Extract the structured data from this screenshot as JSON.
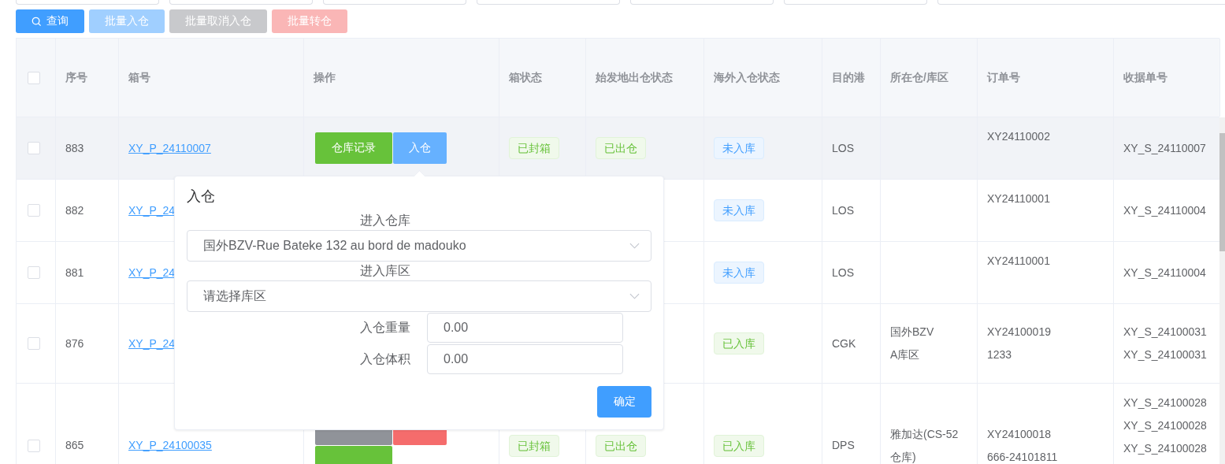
{
  "filter_fields": [
    {
      "kind": "field"
    },
    {
      "kind": "field"
    },
    {
      "kind": "field"
    },
    {
      "kind": "field"
    },
    {
      "kind": "field"
    },
    {
      "kind": "field"
    },
    {
      "kind": "field"
    }
  ],
  "toolbar": [
    {
      "label": "查询",
      "kind": "primary",
      "disabled": false
    },
    {
      "label": "批量入仓",
      "kind": "primary",
      "disabled": true
    },
    {
      "label": "批量取消入仓",
      "kind": "info",
      "disabled": true
    },
    {
      "label": "批量转仓",
      "kind": "danger",
      "disabled": true
    }
  ],
  "table": {
    "header_checkbox": {
      "checked": false
    },
    "columns": [
      "序号",
      "箱号",
      "操作",
      "箱状态",
      "始发地出仓状态",
      "海外入仓状态",
      "目的港",
      "所在仓/库区",
      "订单号",
      "收据单号"
    ],
    "rows": [
      {
        "highlighted": true,
        "checked": false,
        "index": "883",
        "box_no": "XY_P_24110007",
        "actions": [
          {
            "label": "仓库记录",
            "kind": "success"
          },
          {
            "label": "入仓",
            "kind": "primary-light"
          }
        ],
        "box_status": {
          "label": "已封箱",
          "kind": "success"
        },
        "origin_status": {
          "label": "已出仓",
          "kind": "success"
        },
        "overseas_status": {
          "label": "未入库",
          "kind": "primary"
        },
        "port": "LOS",
        "location": [],
        "orders": [
          "XY24110002"
        ],
        "receipts": [
          "XY_S_24110007"
        ]
      },
      {
        "highlighted": false,
        "checked": false,
        "index": "882",
        "box_no": "XY_P_24",
        "actions": [],
        "overseas_status": {
          "label": "未入库",
          "kind": "primary"
        },
        "port": "LOS",
        "location": [],
        "orders": [
          "XY24110001"
        ],
        "receipts": [
          "XY_S_24110004"
        ]
      },
      {
        "highlighted": false,
        "checked": false,
        "index": "881",
        "box_no": "XY_P_24",
        "actions": [],
        "overseas_status": {
          "label": "未入库",
          "kind": "primary"
        },
        "port": "LOS",
        "location": [],
        "orders": [
          "XY24110001"
        ],
        "receipts": [
          "XY_S_24110004"
        ]
      },
      {
        "highlighted": false,
        "checked": false,
        "index": "876",
        "box_no": "XY_P_24",
        "actions": [],
        "overseas_status": {
          "label": "已入库",
          "kind": "success"
        },
        "port": "CGK",
        "location": [
          "国外BZV",
          "A库区"
        ],
        "orders": [
          "XY24100019",
          "1233"
        ],
        "receipts": [
          "XY_S_24100031",
          "XY_S_24100031"
        ]
      },
      {
        "highlighted": false,
        "checked": false,
        "index": "865",
        "box_no": "XY_P_24100035",
        "actions": [
          {
            "kind": "info"
          },
          {
            "kind": "danger"
          },
          {
            "kind": "success"
          }
        ],
        "box_status": {
          "label": "已封箱",
          "kind": "success"
        },
        "origin_status": {
          "label": "已出仓",
          "kind": "success"
        },
        "overseas_status": {
          "label": "已入库",
          "kind": "success"
        },
        "port": "DPS",
        "location": [
          "雅加达(CS-52仓库)"
        ],
        "orders": [
          "XY24100018",
          "666-24101811"
        ],
        "receipts": [
          "XY_S_24100028",
          "XY_S_24100028",
          "XY_S_24100028"
        ]
      }
    ]
  },
  "popover": {
    "title": "入仓",
    "warehouse": {
      "label": "进入仓库",
      "value": "国外BZV-Rue Bateke 132 au bord de madouko"
    },
    "zone": {
      "label": "进入库区",
      "placeholder": "请选择库区"
    },
    "weight": {
      "label": "入仓重量",
      "value": "0.00"
    },
    "volume": {
      "label": "入仓体积",
      "value": "0.00"
    },
    "confirm": "确定"
  }
}
